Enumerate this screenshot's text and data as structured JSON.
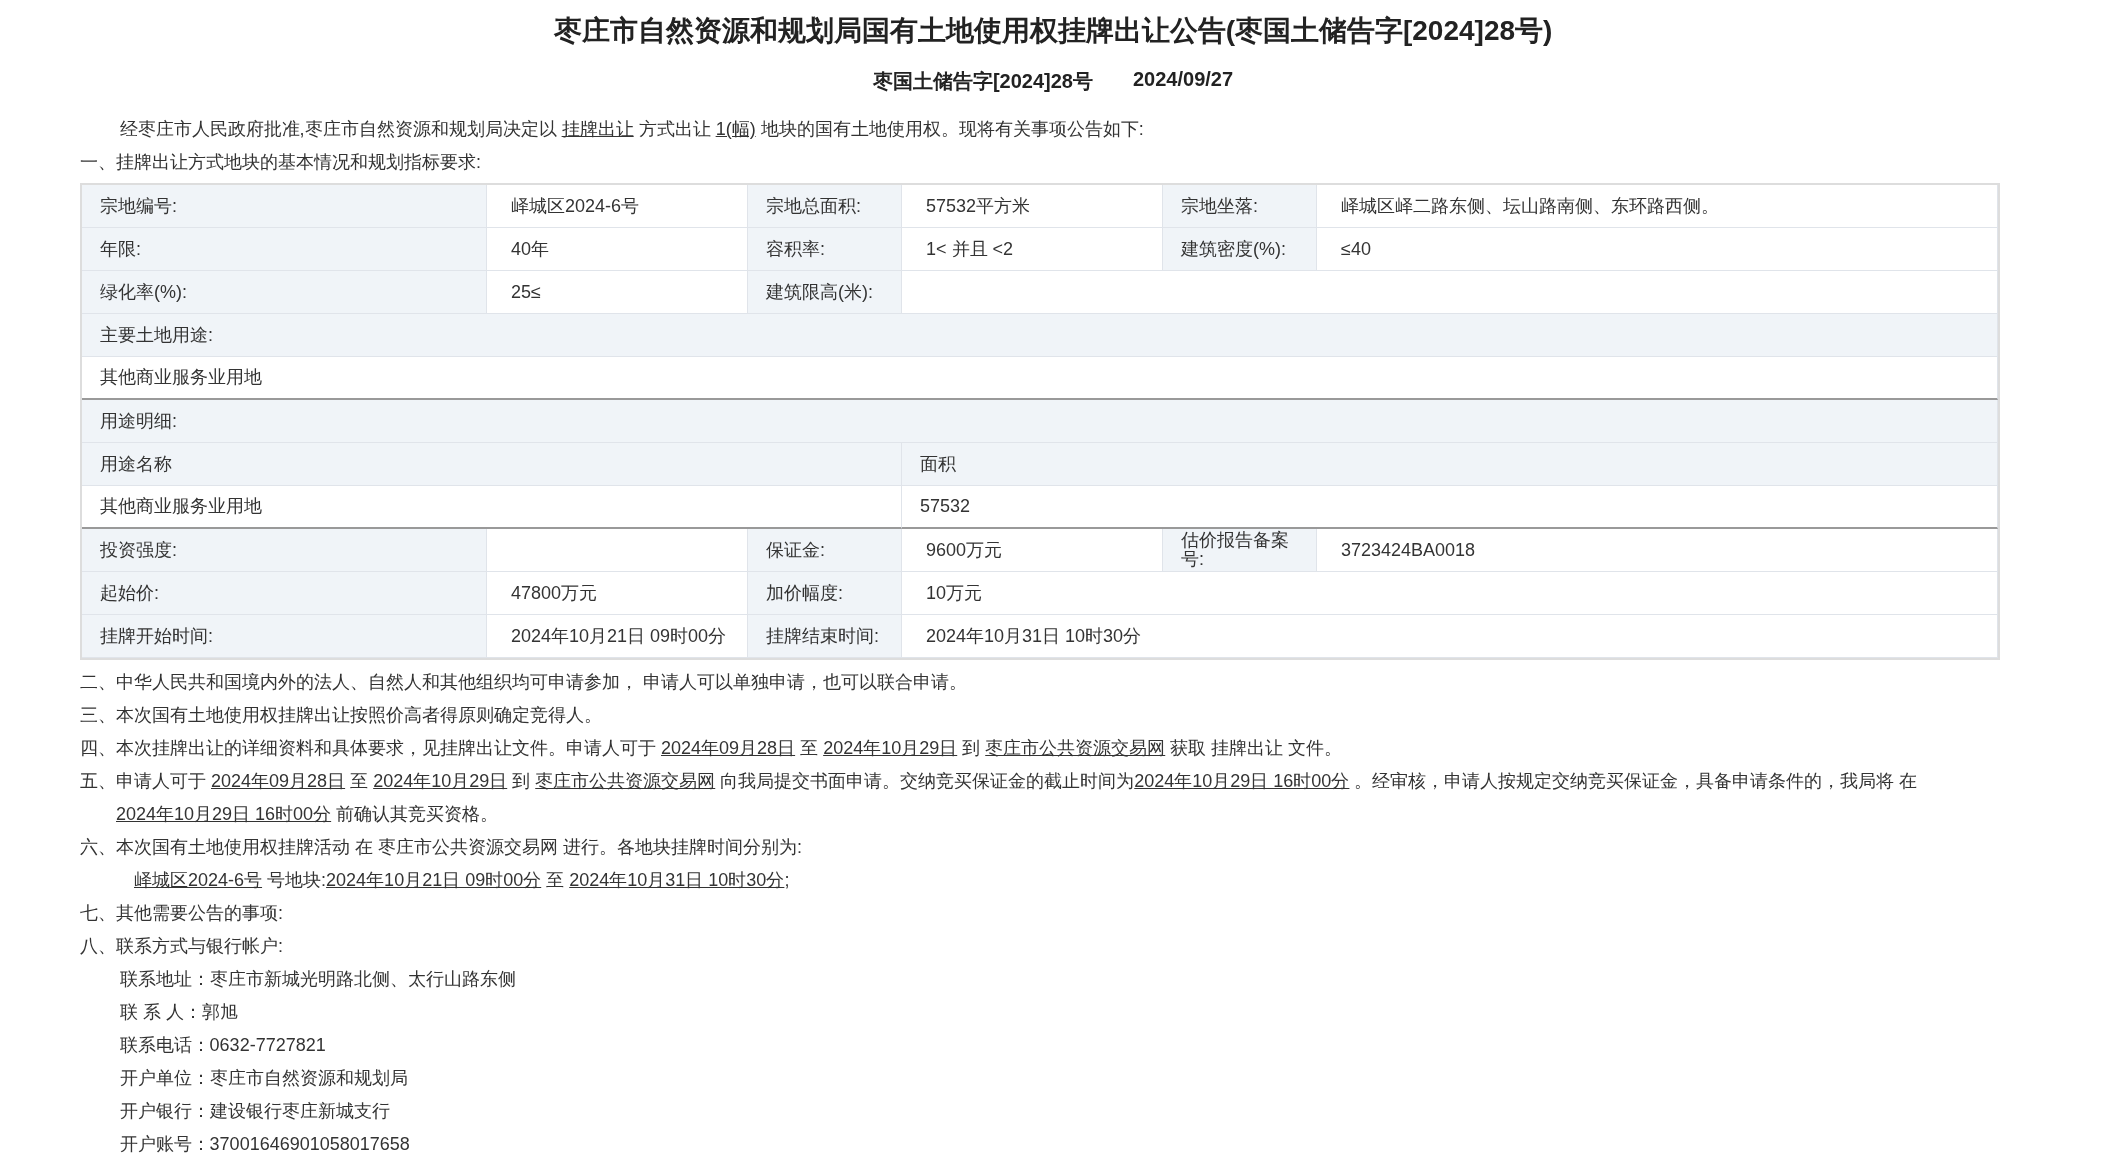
{
  "title": "枣庄市自然资源和规划局国有土地使用权挂牌出让公告(枣国土储告字[2024]28号)",
  "subtitle": {
    "number": "枣国土储告字[2024]28号",
    "date": "2024/09/27"
  },
  "intro": {
    "kind": "intro",
    "segments": [
      {
        "kind": "text",
        "text": "经枣庄市人民政府批准,枣庄市自然资源和规划局决定以 "
      },
      {
        "kind": "link",
        "text": "挂牌出让"
      },
      {
        "kind": "text",
        "text": " 方式出让 "
      },
      {
        "kind": "link",
        "text": "1(幅)"
      },
      {
        "kind": "text",
        "text": " 地块的国有土地使用权。现将有关事项公告如下:"
      }
    ]
  },
  "section_one": "一、挂牌出让方式地块的基本情况和规划指标要求:",
  "table": {
    "rows": [
      {
        "kind": "pairs",
        "cells": [
          {
            "label": "宗地编号:",
            "value": "峄城区2024-6号"
          },
          {
            "label": "宗地总面积:",
            "value": "57532平方米"
          },
          {
            "label": "宗地坐落:",
            "value": "峄城区峄二路东侧、坛山路南侧、东环路西侧。"
          }
        ]
      },
      {
        "kind": "pairs",
        "cells": [
          {
            "label": "年限:",
            "value": "40年"
          },
          {
            "label": "容积率:",
            "value": "1< 并且 <2"
          },
          {
            "label": "建筑密度(%):",
            "value": "≤40"
          }
        ]
      },
      {
        "kind": "pairs",
        "cells": [
          {
            "label": "绿化率(%):",
            "value": "25≤"
          },
          {
            "label": "建筑限高(米):"
          }
        ]
      },
      {
        "kind": "heading",
        "text": "主要土地用途:"
      },
      {
        "kind": "full",
        "text": "其他商业服务业用地"
      },
      {
        "kind": "heading",
        "text": "用途明细:"
      },
      {
        "kind": "detail_head",
        "cells": [
          "用途名称",
          "面积"
        ]
      },
      {
        "kind": "detail_row",
        "cells": [
          "其他商业服务业用地",
          "57532"
        ]
      },
      {
        "kind": "pairs",
        "cells": [
          {
            "label": "投资强度:"
          },
          {
            "label": "保证金:",
            "value": "9600万元"
          },
          {
            "label": "估价报告备案号:",
            "value": "3723424BA0018"
          }
        ]
      },
      {
        "kind": "pairs",
        "cells": [
          {
            "label": "起始价:",
            "value": "47800万元"
          },
          {
            "label": "加价幅度:",
            "value": "10万元"
          }
        ]
      },
      {
        "kind": "pairs",
        "cells": [
          {
            "label": "挂牌开始时间:",
            "value": "2024年10月21日 09时00分"
          },
          {
            "label": "挂牌结束时间:",
            "value": "2024年10月31日 10时30分"
          }
        ]
      }
    ]
  },
  "paragraphs": [
    {
      "kind": "item",
      "segments": [
        {
          "kind": "text",
          "text": "二、中华人民共和国境内外的法人、自然人和其他组织均可申请参加， 申请人可以单独申请，也可以联合申请。"
        }
      ]
    },
    {
      "kind": "item",
      "segments": [
        {
          "kind": "text",
          "text": "三、本次国有土地使用权挂牌出让按照价高者得原则确定竞得人。"
        }
      ]
    },
    {
      "kind": "item",
      "segments": [
        {
          "kind": "text",
          "text": "四、本次挂牌出让的详细资料和具体要求，见挂牌出让文件。申请人可于 "
        },
        {
          "kind": "link",
          "text": "2024年09月28日"
        },
        {
          "kind": "text",
          "text": " 至 "
        },
        {
          "kind": "link",
          "text": "2024年10月29日"
        },
        {
          "kind": "text",
          "text": " 到 "
        },
        {
          "kind": "link",
          "text": "枣庄市公共资源交易网"
        },
        {
          "kind": "text",
          "text": " 获取 挂牌出让 文件。"
        }
      ]
    },
    {
      "kind": "item",
      "segments": [
        {
          "kind": "text",
          "text": "五、申请人可于 "
        },
        {
          "kind": "link",
          "text": "2024年09月28日"
        },
        {
          "kind": "text",
          "text": " 至 "
        },
        {
          "kind": "link",
          "text": "2024年10月29日"
        },
        {
          "kind": "text",
          "text": " 到 "
        },
        {
          "kind": "link",
          "text": "枣庄市公共资源交易网"
        },
        {
          "kind": "text",
          "text": " 向我局提交书面申请。交纳竞买保证金的截止时间为"
        },
        {
          "kind": "link",
          "text": "2024年10月29日 16时00分"
        },
        {
          "kind": "text",
          "text": " 。经审核，申请人按规定交纳竞买保证金，具备申请条件的，我局将 在 "
        },
        {
          "kind": "link",
          "text": "2024年10月29日 16时00分"
        },
        {
          "kind": "text",
          "text": " 前确认其竞买资格。"
        }
      ]
    },
    {
      "kind": "item",
      "segments": [
        {
          "kind": "text",
          "text": "六、本次国有土地使用权挂牌活动 在 枣庄市公共资源交易网 进行。各地块挂牌时间分别为:"
        }
      ]
    },
    {
      "kind": "sub",
      "segments": [
        {
          "kind": "link",
          "text": "峄城区2024-6号"
        },
        {
          "kind": "text",
          "text": " 号地块:"
        },
        {
          "kind": "link",
          "text": "2024年10月21日 09时00分"
        },
        {
          "kind": "text",
          "text": " 至 "
        },
        {
          "kind": "link",
          "text": "2024年10月31日 10时30分"
        },
        {
          "kind": "text",
          "text": ";"
        }
      ]
    },
    {
      "kind": "item",
      "segments": [
        {
          "kind": "text",
          "text": "七、其他需要公告的事项:"
        }
      ]
    },
    {
      "kind": "item",
      "segments": [
        {
          "kind": "text",
          "text": "八、联系方式与银行帐户:"
        }
      ]
    },
    {
      "kind": "contact",
      "segments": [
        {
          "kind": "text",
          "text": "联系地址：枣庄市新城光明路北侧、太行山路东侧"
        }
      ]
    },
    {
      "kind": "contact",
      "segments": [
        {
          "kind": "text",
          "text": "联 系 人：郭旭"
        }
      ]
    },
    {
      "kind": "contact",
      "segments": [
        {
          "kind": "text",
          "text": "联系电话：0632-7727821"
        }
      ]
    },
    {
      "kind": "contact",
      "segments": [
        {
          "kind": "text",
          "text": "开户单位：枣庄市自然资源和规划局"
        }
      ]
    },
    {
      "kind": "contact",
      "segments": [
        {
          "kind": "text",
          "text": "开户银行：建设银行枣庄新城支行"
        }
      ]
    },
    {
      "kind": "contact",
      "segments": [
        {
          "kind": "text",
          "text": "开户账号：37001646901058017658"
        }
      ]
    }
  ]
}
